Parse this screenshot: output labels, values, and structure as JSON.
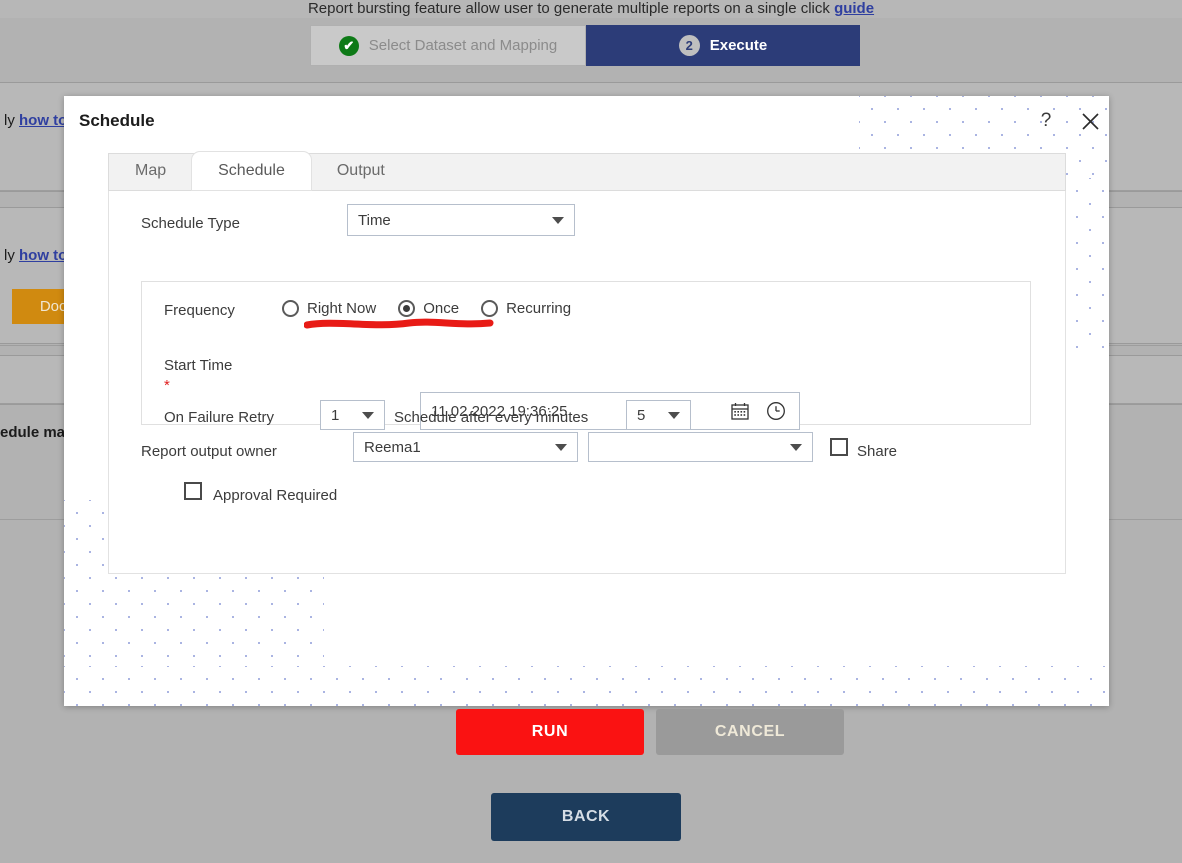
{
  "background": {
    "banner_text": "Report bursting feature allow user to generate multiple reports on a single click",
    "banner_link": "guide",
    "wizard": {
      "step1_label": "Select Dataset and Mapping",
      "step1_badge": "✔",
      "step2_label": "Execute",
      "step2_badge": "2"
    },
    "rows": [
      {
        "text_a": "ly",
        "link": "how to"
      },
      {
        "text_a": "ly",
        "link": "how to"
      }
    ],
    "docx_button": "Docx",
    "schedule_text": "edule ma",
    "back_button": "BACK"
  },
  "modal": {
    "title": "Schedule",
    "help_icon": "?",
    "close_icon": "close-icon",
    "tabs": [
      {
        "label": "Map",
        "active": false
      },
      {
        "label": "Schedule",
        "active": true
      },
      {
        "label": "Output",
        "active": false
      }
    ],
    "schedule_type": {
      "label": "Schedule Type",
      "value": "Time"
    },
    "frequency": {
      "label": "Frequency",
      "options": [
        {
          "label": "Right Now",
          "selected": false
        },
        {
          "label": "Once",
          "selected": true
        },
        {
          "label": "Recurring",
          "selected": false
        }
      ]
    },
    "start_time": {
      "label": "Start Time",
      "required_marker": "*",
      "value": "11.02.2022 19:36:25",
      "calendar_icon": "calendar-icon",
      "clock_icon": "clock-icon"
    },
    "retry": {
      "label": "On Failure Retry",
      "count_value": "1",
      "middle_label": "Schedule after every minutes",
      "minutes_value": "5"
    },
    "owner": {
      "label": "Report output owner",
      "value": "Reema1",
      "secondary_value": "",
      "share_label": "Share",
      "share_checked": false
    },
    "approval": {
      "label": "Approval Required",
      "checked": false
    },
    "buttons": {
      "run": "RUN",
      "cancel": "CANCEL"
    }
  },
  "annotation": {
    "type": "red-underline",
    "color": "#e81b16",
    "target": "start-time-value"
  },
  "colors": {
    "accent_run": "#fa1212",
    "accent_cancel": "#9a9a9a",
    "wizard_active": "#2c3c78",
    "back_button": "#1d3c5c",
    "docx": "#d08a10",
    "required": "#e02020"
  }
}
